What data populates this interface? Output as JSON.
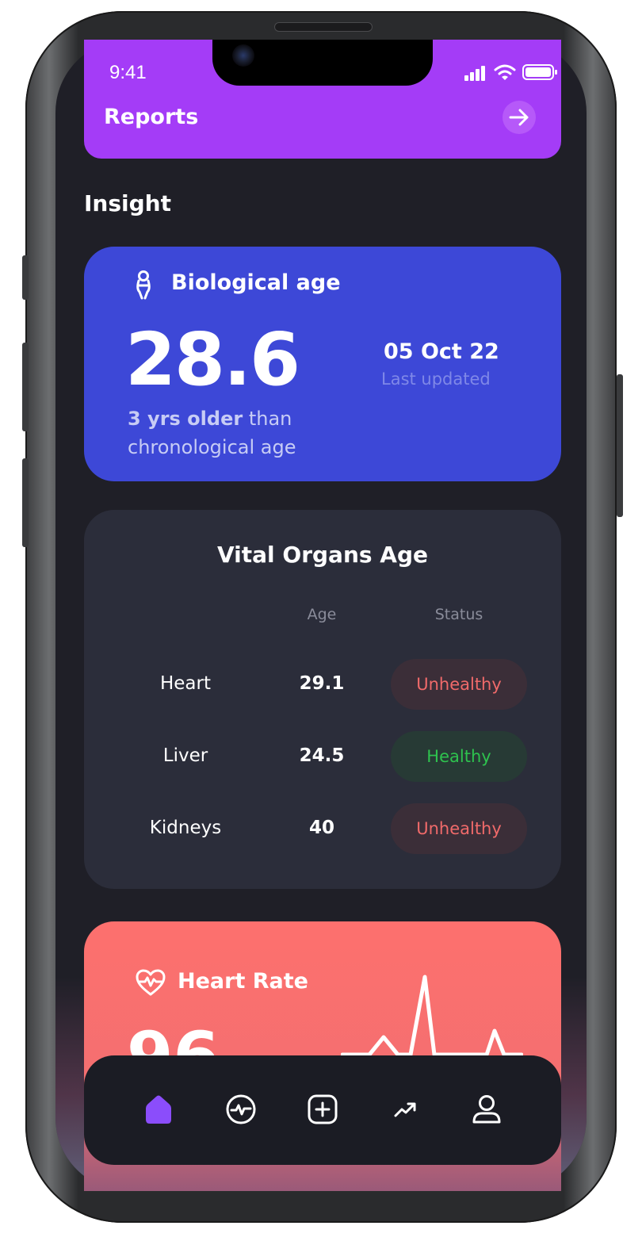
{
  "status_bar": {
    "time": "9:41"
  },
  "reports": {
    "label": "Reports"
  },
  "insight": {
    "title": "Insight"
  },
  "biological_age": {
    "title": "Biological age",
    "value": "28.6",
    "date": "05 Oct 22",
    "date_caption": "Last updated",
    "delta_bold": "3 yrs older",
    "delta_rest": " than chronological age"
  },
  "vital_organs": {
    "title": "Vital Organs Age",
    "columns": {
      "age": "Age",
      "status": "Status"
    },
    "rows": [
      {
        "organ": "Heart",
        "age": "29.1",
        "status": "Unhealthy"
      },
      {
        "organ": "Liver",
        "age": "24.5",
        "status": "Healthy"
      },
      {
        "organ": "Kidneys",
        "age": "40",
        "status": "Unhealthy"
      }
    ]
  },
  "heart_rate": {
    "title": "Heart Rate",
    "value": "96"
  },
  "tab_bar": {
    "items": [
      "home-icon",
      "activity-icon",
      "add-icon",
      "trend-icon",
      "profile-icon"
    ],
    "active": "home-icon"
  },
  "colors": {
    "reports_bg": "#a43cf7",
    "bio_card_bg": "#3d48d7",
    "organs_card_bg": "#2b2d3a",
    "heart_card_bg": "#fd706e",
    "unhealthy": "#f06a6a",
    "healthy": "#2ec24e",
    "active_tab": "#8b4dfb",
    "screen_bg": "#1f1f27"
  }
}
